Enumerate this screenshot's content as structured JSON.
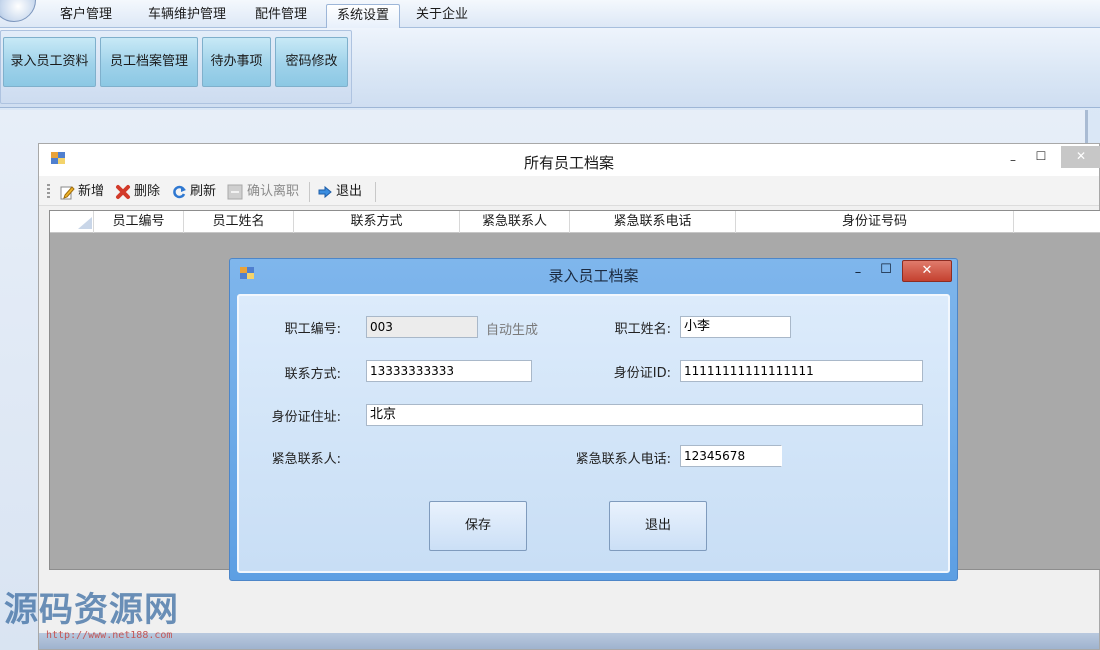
{
  "ribbon": {
    "tabs": [
      {
        "label": "客户管理"
      },
      {
        "label": "车辆维护管理"
      },
      {
        "label": "配件管理"
      },
      {
        "label": "系统设置",
        "active": true
      },
      {
        "label": "关于企业"
      }
    ],
    "buttons": [
      {
        "label": "录入员工资料"
      },
      {
        "label": "员工档案管理"
      },
      {
        "label": "待办事项"
      },
      {
        "label": "密码修改"
      }
    ]
  },
  "archive_window": {
    "title": "所有员工档案",
    "caption": {
      "minimize": "–",
      "maximize": "☐",
      "close": "✕"
    },
    "toolbar": [
      {
        "label": "新增",
        "icon": "edit-icon",
        "enabled": true
      },
      {
        "label": "删除",
        "icon": "delete-icon",
        "enabled": true
      },
      {
        "label": "刷新",
        "icon": "refresh-icon",
        "enabled": true
      },
      {
        "label": "确认离职",
        "icon": "confirm-icon",
        "enabled": false
      },
      {
        "label": "退出",
        "icon": "exit-arrow-icon",
        "enabled": true
      }
    ],
    "columns": [
      "员工编号",
      "员工姓名",
      "联系方式",
      "紧急联系人",
      "紧急联系电话",
      "身份证号码"
    ]
  },
  "dialog": {
    "title": "录入员工档案",
    "caption": {
      "minimize": "–",
      "maximize": "☐",
      "close": "✕"
    },
    "fields": {
      "employee_id": {
        "label": "职工编号:",
        "value": "003",
        "hint": "自动生成"
      },
      "employee_name": {
        "label": "职工姓名:",
        "value": "小李"
      },
      "contact": {
        "label": "联系方式:",
        "value": "13333333333"
      },
      "id_number": {
        "label": "身份证ID:",
        "value": "11111111111111111"
      },
      "id_address": {
        "label": "身份证住址:",
        "value": "北京"
      },
      "emergency_contact": {
        "label": "紧急联系人:",
        "value": ""
      },
      "emergency_phone": {
        "label": "紧急联系人电话:",
        "value": "12345678"
      }
    },
    "buttons": {
      "save": "保存",
      "exit": "退出"
    }
  },
  "watermark": {
    "text": "源码资源网",
    "url": "http://www.net188.com"
  },
  "colors": {
    "ribbon_button": "#9fd2ea",
    "dialog_frame": "#5d9fe3",
    "close_button": "#c4412f",
    "grid_background": "#a9a9a9"
  }
}
